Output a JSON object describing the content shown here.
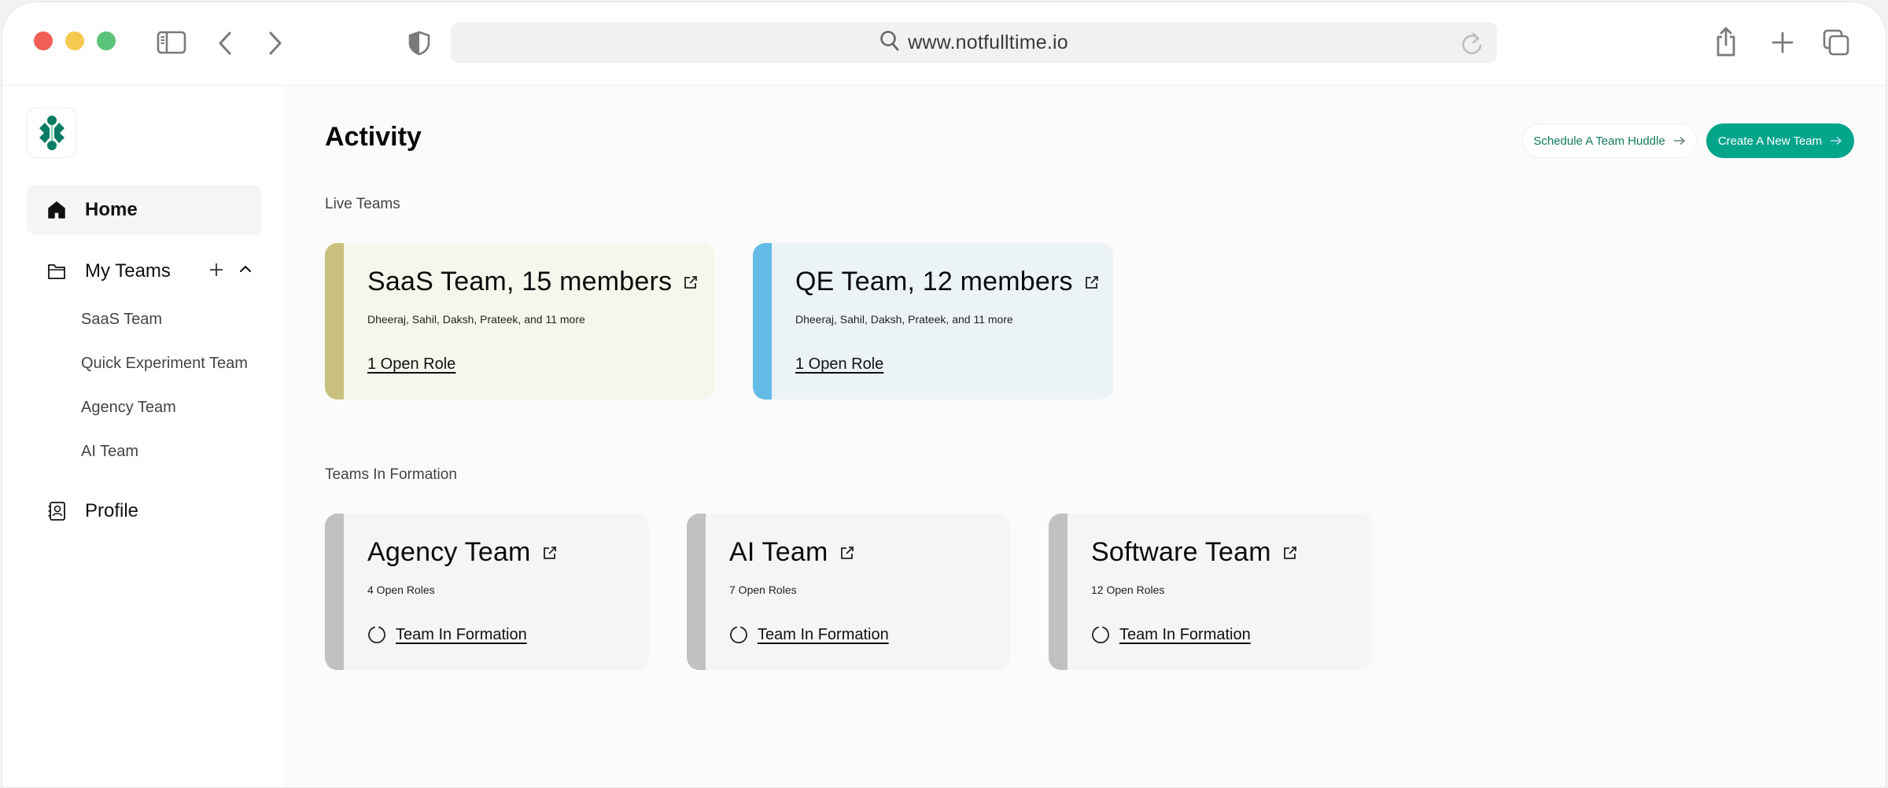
{
  "browser": {
    "url": "www.notfulltime.io",
    "icons": [
      "sidebar-toggle-icon",
      "back-icon",
      "forward-icon",
      "shield-icon",
      "search-icon",
      "reload-icon",
      "share-icon",
      "new-tab-icon",
      "tabs-overview-icon"
    ]
  },
  "sidebar": {
    "logo": "notfulltime-logo",
    "home_label": "Home",
    "my_teams_label": "My Teams",
    "teams": [
      "SaaS Team",
      "Quick Experiment Team",
      "Agency Team",
      "AI Team"
    ],
    "profile_label": "Profile"
  },
  "main": {
    "title": "Activity",
    "buttons": {
      "schedule": "Schedule A Team Huddle",
      "create": "Create A New Team"
    },
    "live_section_label": "Live Teams",
    "live_teams": [
      {
        "title": "SaaS Team, 15 members",
        "members": "Dheeraj, Sahil, Daksh, Prateek, and 11 more",
        "roles_link": "1 Open Role",
        "accent_color": "#c8c07c",
        "bg_color": "#f6f6ec"
      },
      {
        "title": "QE Team, 12 members",
        "members": "Dheeraj, Sahil, Daksh, Prateek, and 11 more",
        "roles_link": "1 Open Role",
        "accent_color": "#63bbe6",
        "bg_color": "#ecf3f7"
      }
    ],
    "formation_section_label": "Teams In Formation",
    "formation_teams": [
      {
        "title": "Agency Team",
        "roles": "4 Open Roles",
        "status_link": "Team In Formation"
      },
      {
        "title": "AI Team",
        "roles": "7 Open Roles",
        "status_link": "Team In Formation"
      },
      {
        "title": "Software Team",
        "roles": "12 Open Roles",
        "status_link": "Team In Formation"
      }
    ],
    "formation_accent_color": "#c0c1c0",
    "formation_bg_color": "#f4f5f5"
  },
  "colors": {
    "brand": "#0b7c64",
    "primary_button": "#05a58a"
  }
}
